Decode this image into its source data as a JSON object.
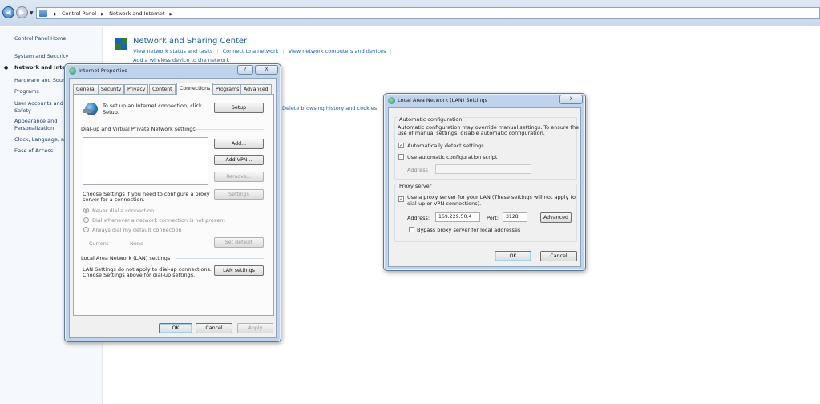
{
  "address_bar": {
    "crumbs": [
      "Control Panel",
      "Network and Internet"
    ]
  },
  "left_pane": {
    "items": [
      {
        "label": "Control Panel Home"
      },
      {
        "label": "System and Security"
      },
      {
        "label": "Network and Internet"
      },
      {
        "label": "Hardware and Sound"
      },
      {
        "label": "Programs"
      },
      {
        "label": "User Accounts and Family"
      },
      {
        "label": "Safety"
      },
      {
        "label": "Appearance and"
      },
      {
        "label": "Personalization"
      },
      {
        "label": "Clock, Language, and Region"
      },
      {
        "label": "Ease of Access"
      }
    ]
  },
  "main": {
    "nsc_title": "Network and Sharing Center",
    "nsc_links": [
      "View network status and tasks",
      "Connect to a network",
      "View network computers and devices"
    ],
    "nsc_sub": "Add a wireless device to the network",
    "delete_history": "Delete browsing history and cookies"
  },
  "inet_props": {
    "title": "Internet Properties",
    "help_btn": "?",
    "close_btn": "X",
    "tabs": [
      "General",
      "Security",
      "Privacy",
      "Content",
      "Connections",
      "Programs",
      "Advanced"
    ],
    "setup_text": "To set up an Internet connection, click Setup.",
    "setup_btn": "Setup",
    "dialup_group": "Dial-up and Virtual Private Network settings",
    "add_btn": "Add...",
    "add_vpn_btn": "Add VPN...",
    "remove_btn": "Remove...",
    "settings_btn": "Settings",
    "choose_text_1": "Choose Settings if you need to configure a proxy",
    "choose_text_2": "server for a connection.",
    "radio_never": "Never dial a connection",
    "radio_whenever": "Dial whenever a network connection is not present",
    "radio_always": "Always dial my default connection",
    "current_label": "Current",
    "current_value": "None",
    "set_default_btn": "Set default",
    "lan_group": "Local Area Network (LAN) settings",
    "lan_text_1": "LAN Settings do not apply to dial-up connections.",
    "lan_text_2": "Choose Settings above for dial-up settings.",
    "lan_btn": "LAN settings",
    "ok_btn": "OK",
    "cancel_btn": "Cancel",
    "apply_btn": "Apply"
  },
  "lan_dialog": {
    "title": "Local Area Network (LAN) Settings",
    "close_btn": "X",
    "auto_group": "Automatic configuration",
    "auto_text_1": "Automatic configuration may override manual settings.  To ensure the",
    "auto_text_2": "use of manual settings, disable automatic configuration.",
    "auto_detect": "Automatically detect settings",
    "auto_detect_checked": true,
    "use_script": "Use automatic configuration script",
    "use_script_checked": false,
    "address_label": "Address",
    "proxy_group": "Proxy server",
    "use_proxy_1": "Use a proxy server for your LAN (These settings will not apply to",
    "use_proxy_2": "dial-up or VPN connections).",
    "use_proxy_checked": true,
    "proxy_address_label": "Address:",
    "proxy_address_value": "169.229.50.4",
    "port_label": "Port:",
    "port_value": "3128",
    "advanced_btn": "Advanced",
    "bypass": "Bypass proxy server for local addresses",
    "bypass_checked": false,
    "ok_btn": "OK",
    "cancel_btn": "Cancel"
  }
}
